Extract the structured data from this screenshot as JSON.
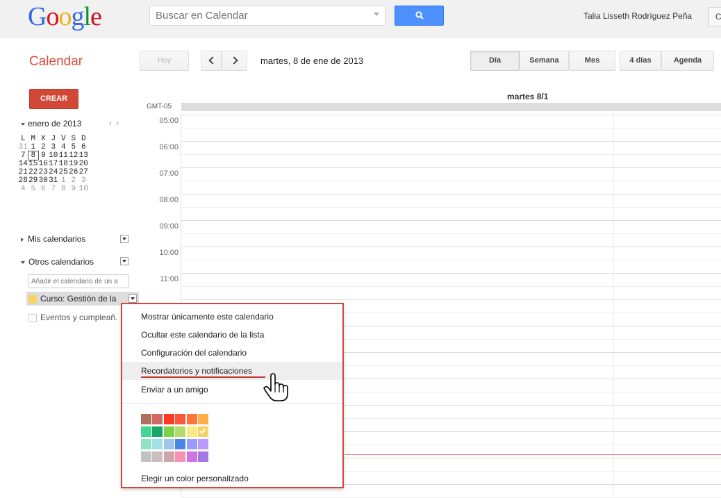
{
  "header": {
    "logo": "Google",
    "search_placeholder": "Buscar en Calendar",
    "user_name": "Talia Lisseth Rodríguez Peña",
    "user_button": "C"
  },
  "toolbar": {
    "app_title": "Calendar",
    "today_label": "Hoy",
    "date_label": "martes, 8 de ene de 2013",
    "views": [
      "Día",
      "Semana",
      "Mes",
      "4 días",
      "Agenda"
    ],
    "active_view": "Día"
  },
  "sidebar": {
    "create_label": "CREAR",
    "mini_month": "enero de 2013",
    "weekdays": [
      "L",
      "M",
      "X",
      "J",
      "V",
      "S",
      "D"
    ],
    "weeks": [
      [
        "31",
        "1",
        "2",
        "3",
        "4",
        "5",
        "6"
      ],
      [
        "7",
        "8",
        "9",
        "10",
        "11",
        "12",
        "13"
      ],
      [
        "14",
        "15",
        "16",
        "17",
        "18",
        "19",
        "20"
      ],
      [
        "21",
        "22",
        "23",
        "24",
        "25",
        "26",
        "27"
      ],
      [
        "28",
        "29",
        "30",
        "31",
        "1",
        "2",
        "3"
      ],
      [
        "4",
        "5",
        "6",
        "7",
        "8",
        "9",
        "10"
      ]
    ],
    "selected_day": "8",
    "my_calendars_label": "Mis calendarios",
    "other_calendars_label": "Otros calendarios",
    "add_calendar_placeholder": "Añadir el calendario de un a",
    "calendars": [
      {
        "label": "Curso: Gestión de la",
        "color": "#fad165"
      },
      {
        "label": "Eventos y cumpleañ.",
        "color": "#ffffff"
      }
    ]
  },
  "day_view": {
    "day_header": "martes 8/1",
    "timezone": "GMT-05",
    "hours": [
      "05:00",
      "06:00",
      "07:00",
      "08:00",
      "09:00",
      "10:00",
      "11:00"
    ]
  },
  "context_menu": {
    "items": [
      "Mostrar únicamente este calendario",
      "Ocultar este calendario de la lista",
      "Configuración del calendario",
      "Recordatorios y notificaciones",
      "Enviar a un amigo"
    ],
    "hovered_item": "Recordatorios y notificaciones",
    "custom_color_label": "Elegir un color personalizado",
    "color_rows": [
      [
        "#ac725e",
        "#d06b64",
        "#f83a22",
        "#fa573c",
        "#ff7537",
        "#ffad46"
      ],
      [
        "#42d692",
        "#16a765",
        "#7bd148",
        "#b3dc6c",
        "#fbe983",
        "#fad165"
      ],
      [
        "#92e1c0",
        "#9fe1e7",
        "#9fc6e7",
        "#4986e7",
        "#9a9cff",
        "#b99aff"
      ],
      [
        "#c2c2c2",
        "#cabdbf",
        "#cca6ac",
        "#f691b2",
        "#cd74e6",
        "#a47ae2"
      ]
    ],
    "selected_color": "#fad165"
  }
}
